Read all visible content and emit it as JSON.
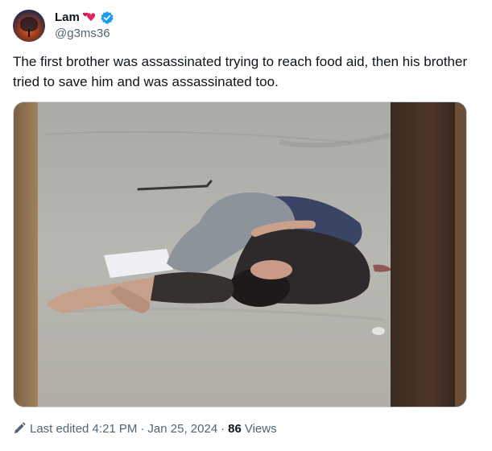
{
  "author": {
    "name": "Lam",
    "handle": "@g3ms36"
  },
  "tweet": {
    "text": "The first brother was assassinated trying to reach food aid, then his brother tried to save him and was assassinated too."
  },
  "footer": {
    "edited_label": "Last edited 4:21 PM",
    "separator": "·",
    "date": "Jan 25, 2024",
    "views_count": "86",
    "views_label": "Views"
  },
  "colors": {
    "verified": "#1d9bf0",
    "secondary_text": "#536471",
    "hearts": "#e0245e"
  }
}
